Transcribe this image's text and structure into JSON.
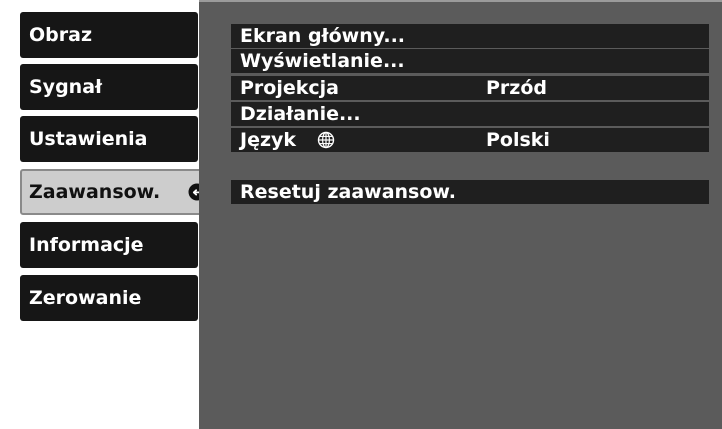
{
  "sidebar": {
    "items": [
      {
        "label": "Obraz"
      },
      {
        "label": "Sygnał"
      },
      {
        "label": "Ustawienia"
      },
      {
        "label": "Zaawansow.",
        "active": true
      },
      {
        "label": "Informacje"
      },
      {
        "label": "Zerowanie"
      }
    ]
  },
  "menu": {
    "rows": [
      {
        "label": "Ekran główny...",
        "value": ""
      },
      {
        "label": "Wyświetlanie...",
        "value": ""
      },
      {
        "label": "Projekcja",
        "value": "Przód"
      },
      {
        "label": "Działanie...",
        "value": ""
      },
      {
        "label": "Język",
        "value": "Polski",
        "icon": "globe-icon"
      }
    ],
    "reset": {
      "label": "Resetuj zaawansow."
    }
  },
  "colors": {
    "background": "#ffffff",
    "panel": "#5b5b5b",
    "row": "#1f1f1f",
    "button": "#161616",
    "active_button": "#cdcdcd"
  }
}
